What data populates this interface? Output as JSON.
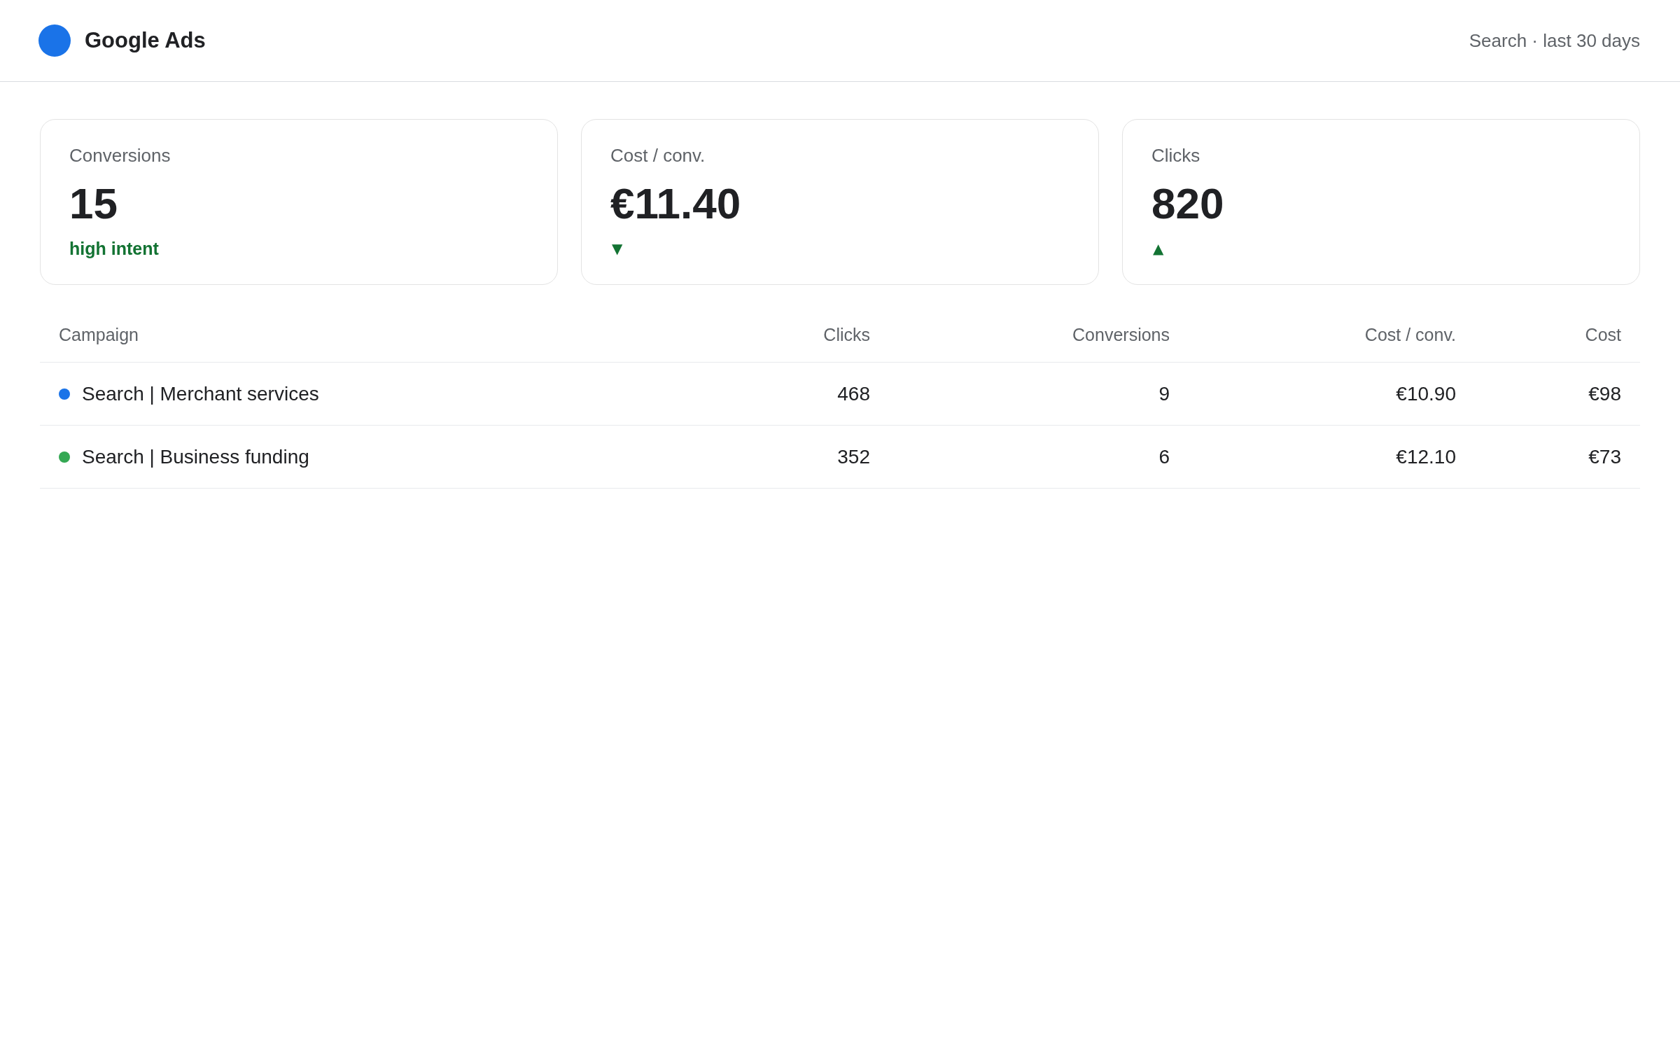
{
  "header": {
    "title": "Google Ads",
    "context": "Search · last 30 days"
  },
  "metrics": [
    {
      "label": "Conversions",
      "value": "15",
      "note": "high intent",
      "kind": "text"
    },
    {
      "label": "Cost / conv.",
      "value": "€11.40",
      "note": "▼",
      "kind": "trend"
    },
    {
      "label": "Clicks",
      "value": "820",
      "note": "▲",
      "kind": "trend"
    }
  ],
  "table": {
    "columns": [
      "Campaign",
      "Clicks",
      "Conversions",
      "Cost / conv.",
      "Cost"
    ],
    "rows": [
      {
        "color": "#1a73e8",
        "cells": [
          "Search | Merchant services",
          "468",
          "9",
          "€10.90",
          "€98"
        ]
      },
      {
        "color": "#34a853",
        "cells": [
          "Search | Business funding",
          "352",
          "6",
          "€12.10",
          "€73"
        ]
      }
    ]
  }
}
